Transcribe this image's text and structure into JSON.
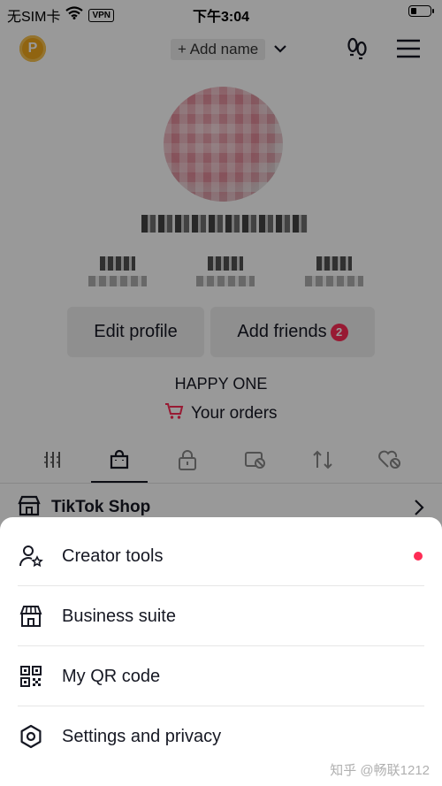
{
  "status_bar": {
    "carrier": "无SIM卡",
    "vpn": "VPN",
    "time": "下午3:04",
    "battery_level": 0.3
  },
  "header": {
    "coin_letter": "P",
    "add_name_label": "+ Add name"
  },
  "profile": {
    "edit_profile_label": "Edit profile",
    "add_friends_label": "Add friends",
    "add_friends_badge": "2",
    "bio": "HAPPY ONE",
    "orders_label": "Your orders"
  },
  "tabs": [
    {
      "name": "videos-grid-icon"
    },
    {
      "name": "shop-bag-icon"
    },
    {
      "name": "lock-icon"
    },
    {
      "name": "hidden-tag-icon"
    },
    {
      "name": "repost-icon"
    },
    {
      "name": "liked-hidden-icon"
    }
  ],
  "shop_row": {
    "label": "TikTok Shop"
  },
  "sheet": {
    "items": [
      {
        "label": "Creator tools",
        "icon": "creator-tools-icon",
        "has_dot": true
      },
      {
        "label": "Business suite",
        "icon": "store-icon",
        "has_dot": false
      },
      {
        "label": "My QR code",
        "icon": "qr-code-icon",
        "has_dot": false
      },
      {
        "label": "Settings and privacy",
        "icon": "gear-icon",
        "has_dot": false
      }
    ]
  },
  "watermark": "知乎 @畅联1212",
  "colors": {
    "accent": "#fe2c55",
    "coin": "#f0a71b",
    "text": "#161823"
  }
}
